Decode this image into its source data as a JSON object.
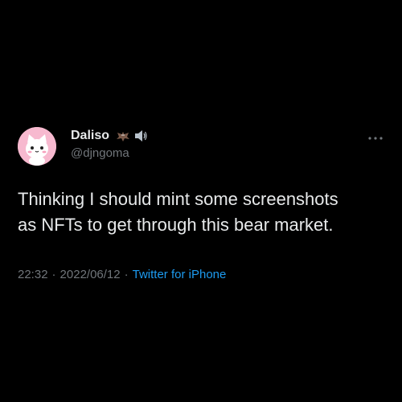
{
  "user": {
    "display_name": "Daliso",
    "handle": "@djngoma",
    "name_emojis": [
      "bat-icon",
      "speaker-icon"
    ]
  },
  "tweet": {
    "text": "Thinking I should mint some screenshots\nas NFTs to get through this bear market."
  },
  "meta": {
    "time": "22:32",
    "separator": "·",
    "date": "2022/06/12",
    "source": "Twitter for iPhone"
  },
  "colors": {
    "background": "#000000",
    "text": "#e7e9ea",
    "secondary": "#71767b",
    "accent": "#1d9bf0",
    "avatar_bg": "#f7b9cf"
  }
}
